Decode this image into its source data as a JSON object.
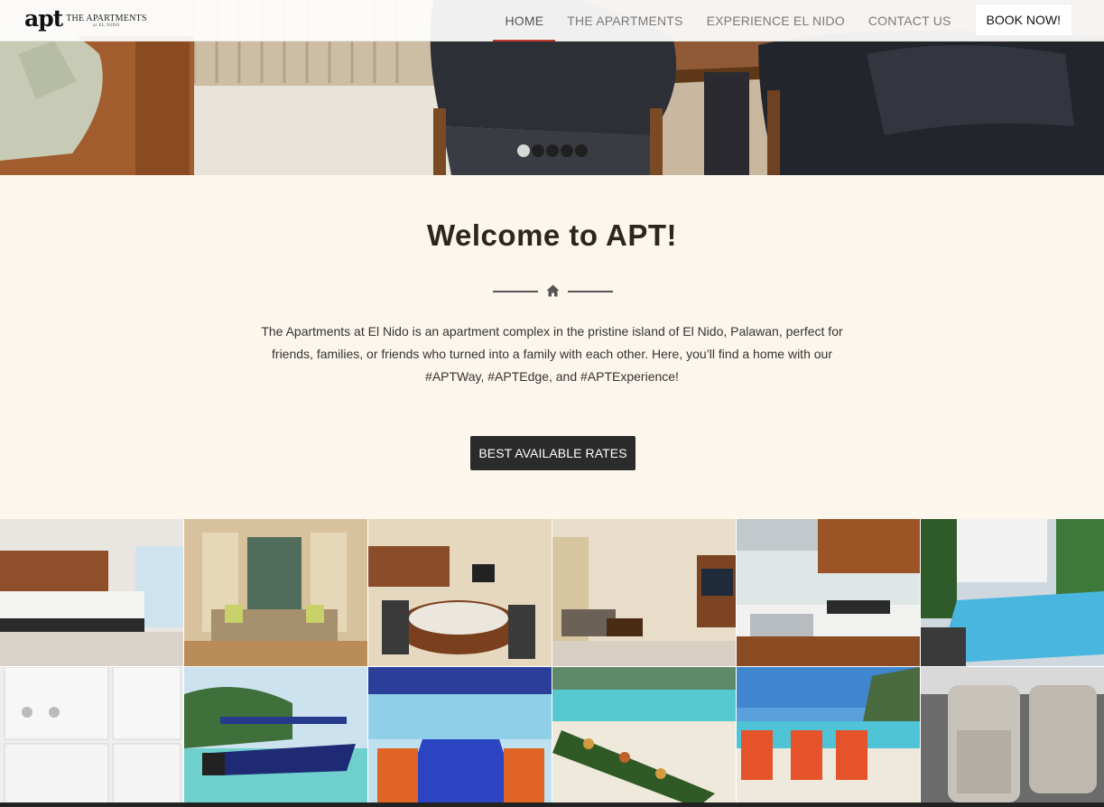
{
  "header": {
    "logo_mark": "apt",
    "logo_name": "THE APARTMENTS",
    "logo_tagline": "at EL NIDO",
    "nav": [
      {
        "label": "HOME",
        "active": true
      },
      {
        "label": "THE APARTMENTS",
        "active": false
      },
      {
        "label": "EXPERIENCE EL NIDO",
        "active": false
      },
      {
        "label": "CONTACT US",
        "active": false
      }
    ],
    "book_label": "BOOK NOW!"
  },
  "hero": {
    "slides": 5,
    "active_slide": 1
  },
  "welcome": {
    "title": "Welcome to APT!",
    "divider_icon": "home-icon",
    "description": "The Apartments at El Nido is an apartment complex in the pristine island of El Nido, Palawan, perfect for friends, families, or friends who turned into a family with each other. Here, you’ll find a home with our #APTWay,  #APTEdge, and #APTExperience!",
    "cta_label": "BEST AVAILABLE RATES"
  },
  "gallery": {
    "tiles": [
      "bedroom-photo",
      "living-room-photo",
      "dining-area-photo",
      "apartment-interior-photo",
      "kitchen-photo",
      "pool-photo",
      "laundry-photo",
      "boat-photo",
      "boat-deck-photo",
      "beach-feast-photo",
      "life-vests-photo",
      "van-interior-photo"
    ]
  },
  "colors": {
    "background": "#fcf6ec",
    "accent": "#c0392b",
    "button": "#2b2b2b"
  }
}
